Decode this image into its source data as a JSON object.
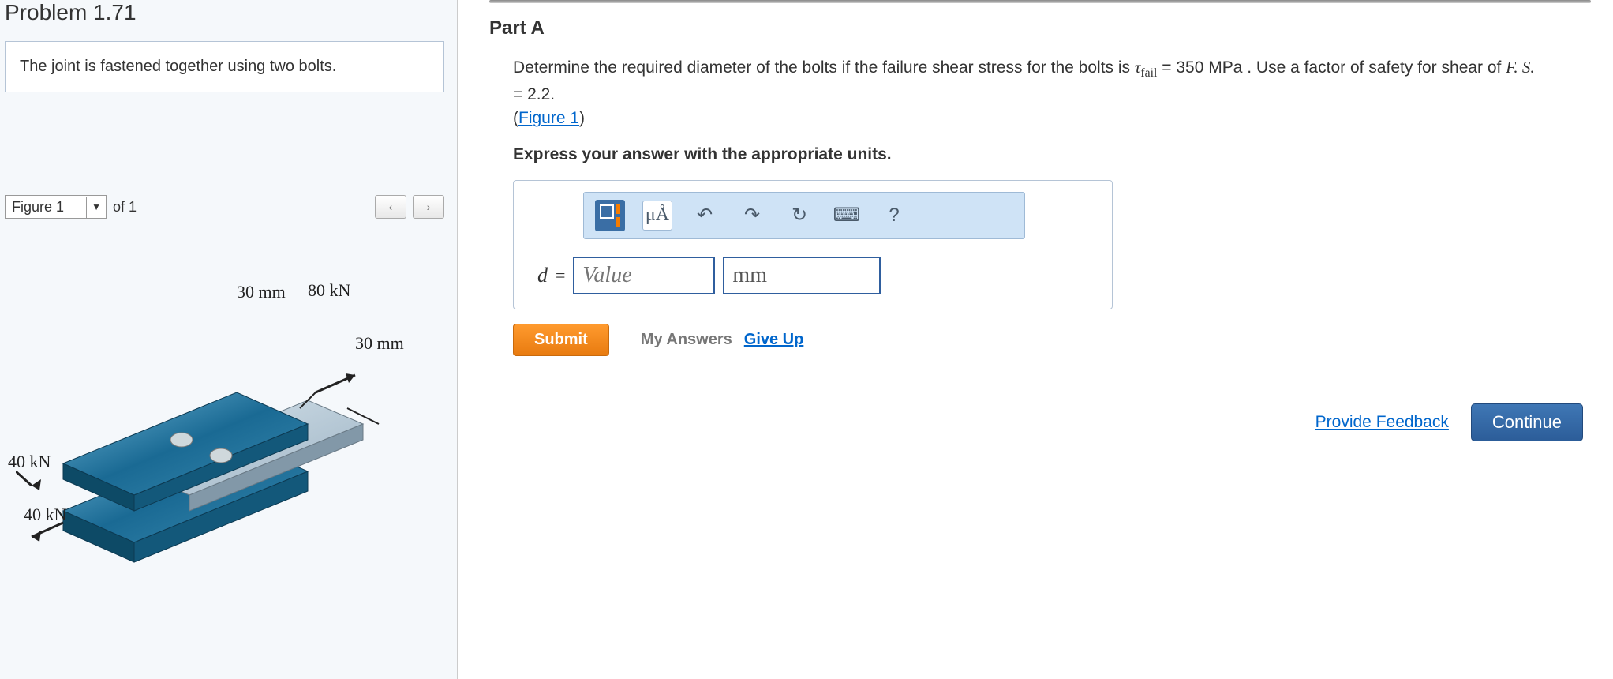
{
  "problem": {
    "title": "Problem 1.71",
    "statement": "The joint is fastened together using two bolts."
  },
  "figure": {
    "select_label": "Figure 1",
    "of_text": "of 1",
    "labels": {
      "dim1": "30 mm",
      "force_top": "80 kN",
      "dim2": "30 mm",
      "force_left1": "40 kN",
      "force_left2": "40 kN"
    }
  },
  "part": {
    "heading": "Part A",
    "q_pre": "Determine the required diameter of the bolts if the failure shear stress for the bolts is ",
    "tau_sym": "τ",
    "tau_sub": "fail",
    "tau_val": " = 350 MPa",
    "q_mid": " . Use a factor of safety for shear of ",
    "fs_sym": "F. S.",
    "fs_val": " = 2.2.",
    "figlink": "Figure 1",
    "instruction": "Express your answer with the appropriate units."
  },
  "toolbar": {
    "units_label": "μÅ",
    "help_label": "?"
  },
  "answer": {
    "var": "d",
    "eq": "=",
    "placeholder": "Value",
    "unit": "mm"
  },
  "actions": {
    "submit": "Submit",
    "my_answers": "My Answers",
    "give_up": "Give Up",
    "feedback": "Provide Feedback",
    "continue": "Continue"
  }
}
